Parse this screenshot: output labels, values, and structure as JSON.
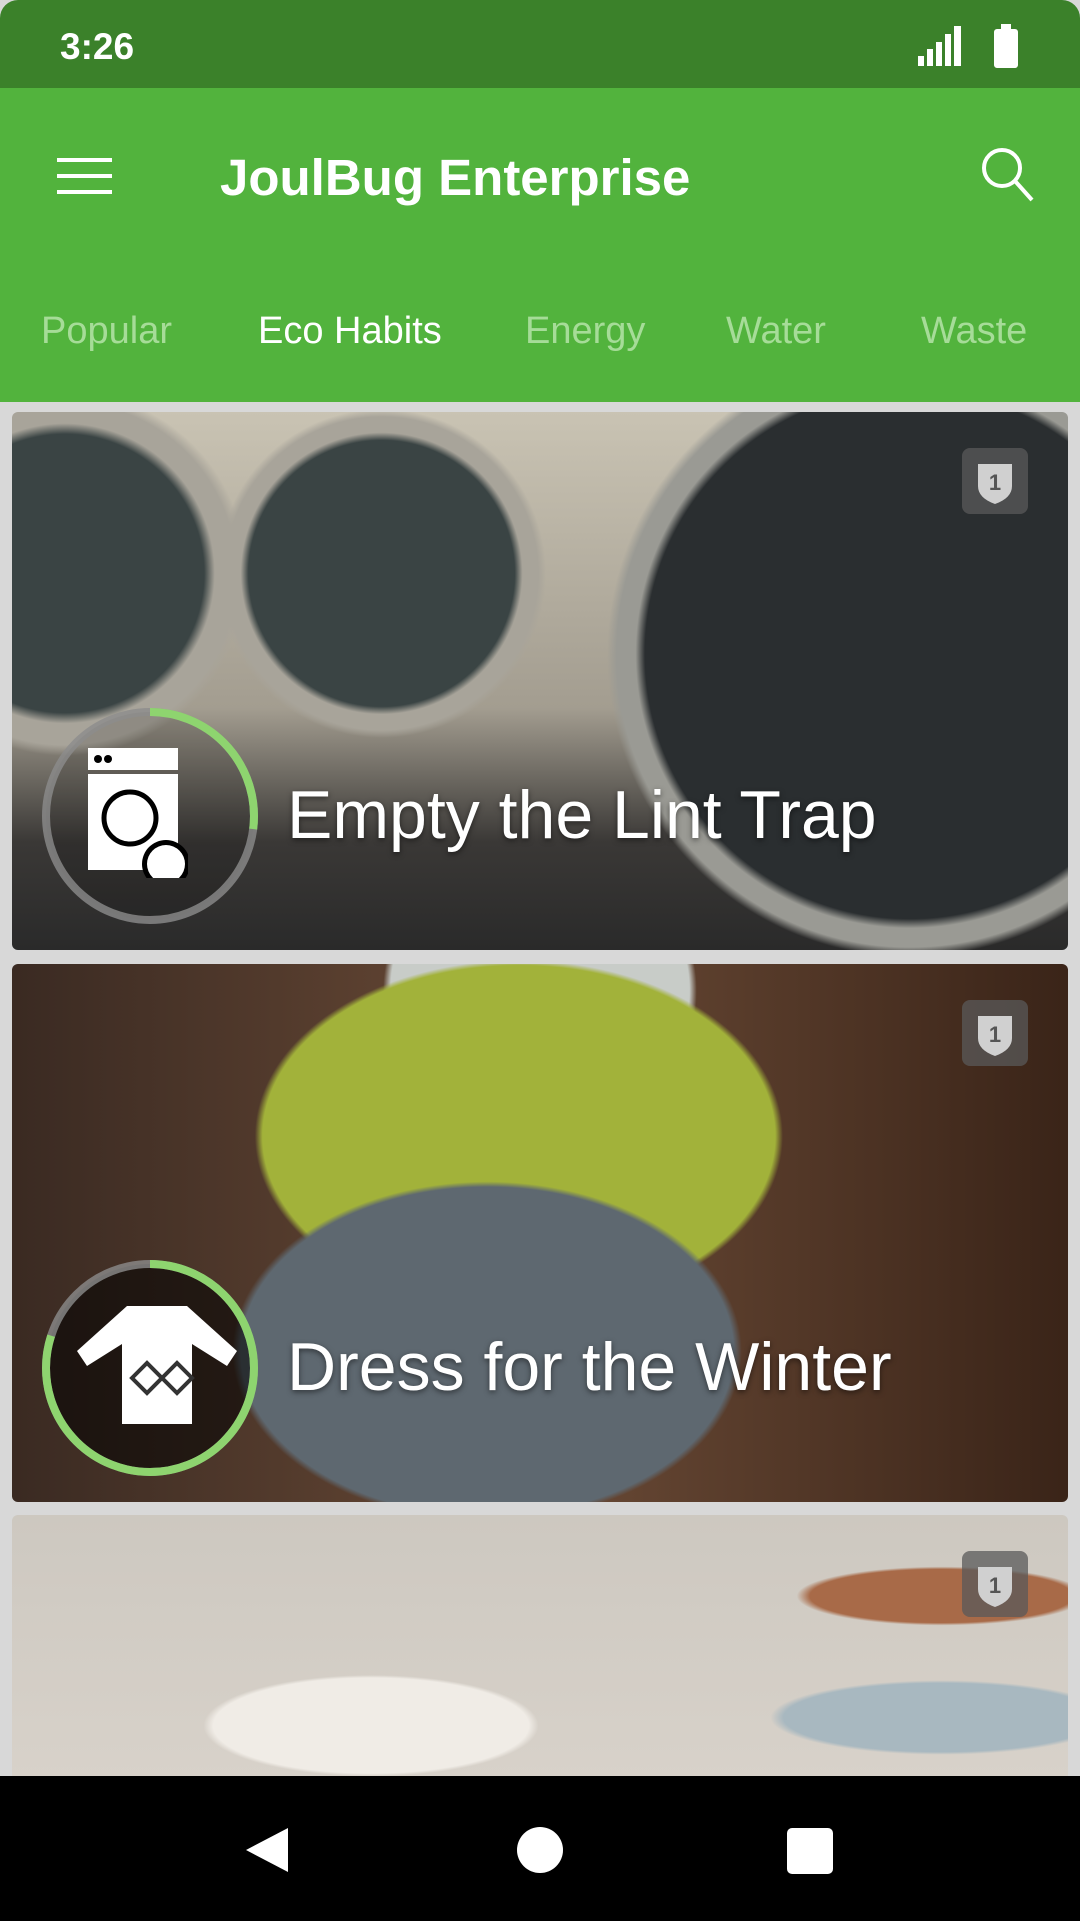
{
  "status_bar": {
    "time": "3:26",
    "icons": [
      "signal-icon",
      "battery-icon"
    ]
  },
  "app_bar": {
    "title": "JoulBug Enterprise",
    "menu_icon": "hamburger-menu-icon",
    "search_icon": "search-icon"
  },
  "tabs": [
    {
      "label": "Popular",
      "active": false
    },
    {
      "label": "Eco Habits",
      "active": true
    },
    {
      "label": "Energy",
      "active": false
    },
    {
      "label": "Water",
      "active": false
    },
    {
      "label": "Waste",
      "active": false
    }
  ],
  "cards": [
    {
      "title": "Empty the Lint Trap",
      "icon": "washing-machine-icon",
      "progress": 0.27,
      "badge": "1"
    },
    {
      "title": "Dress for the Winter",
      "icon": "sweater-icon",
      "progress": 0.8,
      "badge": "1"
    },
    {
      "title": "",
      "icon": "",
      "badge": "1"
    }
  ],
  "colors": {
    "status_bar": "#3b812a",
    "app_bar": "#52b33d",
    "progress": "#8ed46f",
    "tab_inactive": "#a6dc98"
  },
  "nav_bar": {
    "icons": [
      "back-icon",
      "home-icon",
      "recents-icon"
    ]
  }
}
